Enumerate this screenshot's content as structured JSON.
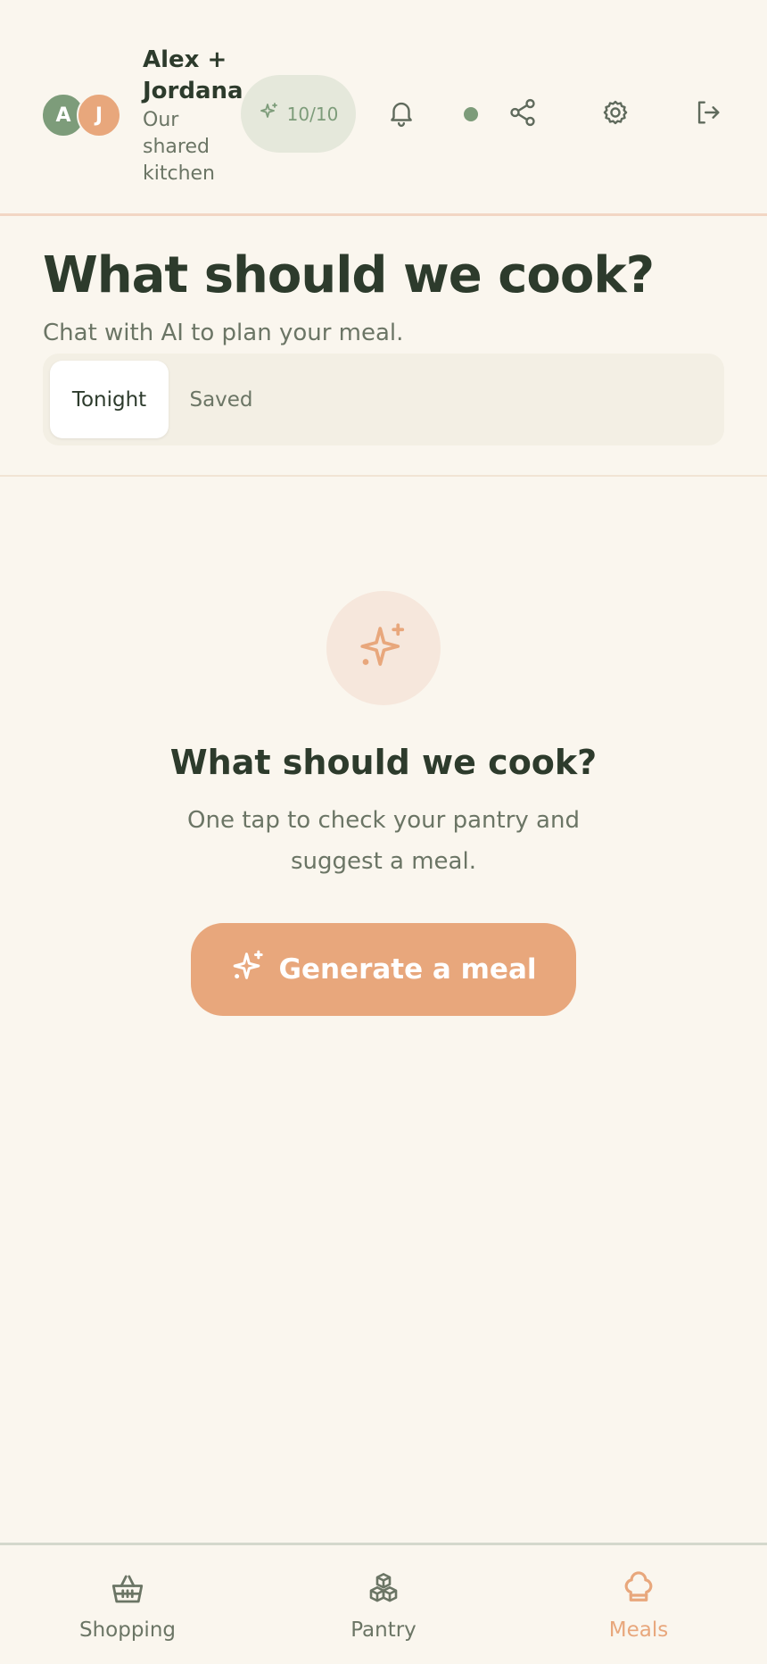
{
  "header": {
    "avatars": [
      {
        "initial": "A",
        "color": "#7d9c7a"
      },
      {
        "initial": "J",
        "color": "#e8a77c"
      }
    ],
    "kitchen_name": "Alex + Jordana",
    "kitchen_subtitle": "Our shared kitchen",
    "credits": "10/10",
    "icons": [
      "bell-icon",
      "status-dot",
      "share-icon",
      "gear-icon",
      "logout-icon"
    ]
  },
  "main": {
    "title": "What should we cook?",
    "subtitle": "Chat with AI to plan your meal.",
    "tabs": [
      {
        "label": "Tonight",
        "active": true
      },
      {
        "label": "Saved",
        "active": false
      }
    ]
  },
  "empty_state": {
    "icon": "sparkle-icon",
    "title": "What should we cook?",
    "text": "One tap to check your pantry and suggest a meal.",
    "button_label": "Generate a meal"
  },
  "bottom_nav": {
    "items": [
      {
        "label": "Shopping",
        "icon": "basket-icon",
        "active": false
      },
      {
        "label": "Pantry",
        "icon": "cubes-icon",
        "active": false
      },
      {
        "label": "Meals",
        "icon": "chef-hat-icon",
        "active": true
      }
    ]
  },
  "colors": {
    "background": "#faf6ee",
    "accent": "#e8a77c",
    "green": "#7d9c7a",
    "text": "#2d3b2c",
    "muted": "#6b7565"
  }
}
